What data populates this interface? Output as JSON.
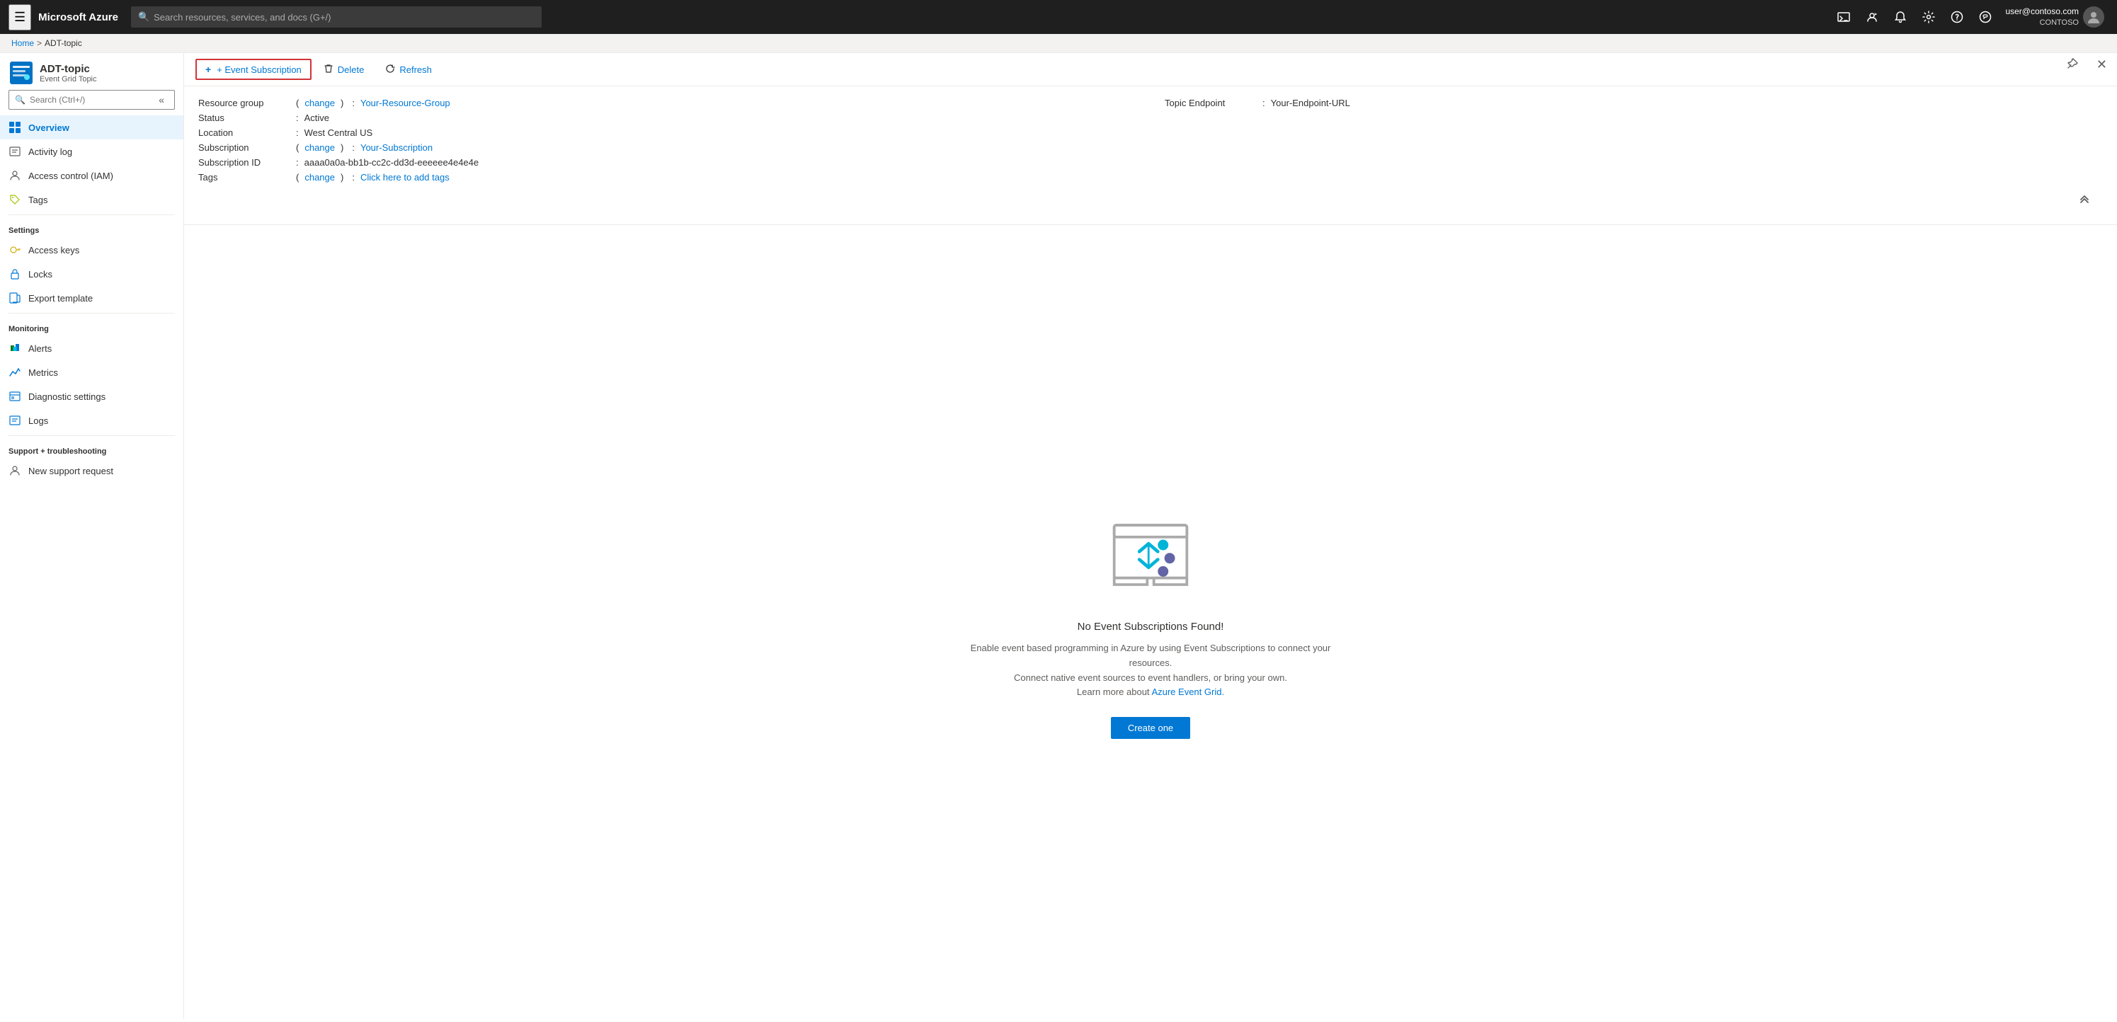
{
  "topnav": {
    "menu_icon": "☰",
    "logo": "Microsoft Azure",
    "search_placeholder": "Search resources, services, and docs (G+/)",
    "cloud_icon": "🖥",
    "feedback_icon": "💬",
    "notification_icon": "🔔",
    "settings_icon": "⚙",
    "help_icon": "?",
    "smiley_icon": "🙂",
    "user_name": "user@contoso.com",
    "user_tenant": "CONTOSO",
    "avatar_initials": "👤"
  },
  "breadcrumb": {
    "home": "Home",
    "separator": ">",
    "current": "ADT-topic"
  },
  "sidebar": {
    "resource_icon": "⊞",
    "title": "ADT-topic",
    "subtitle": "Event Grid Topic",
    "search_placeholder": "Search (Ctrl+/)",
    "collapse_icon": "«",
    "items": [
      {
        "id": "overview",
        "label": "Overview",
        "icon": "⬜",
        "active": true
      },
      {
        "id": "activity-log",
        "label": "Activity log",
        "icon": "📋"
      },
      {
        "id": "access-control",
        "label": "Access control (IAM)",
        "icon": "👤"
      },
      {
        "id": "tags",
        "label": "Tags",
        "icon": "🏷"
      }
    ],
    "sections": [
      {
        "label": "Settings",
        "items": [
          {
            "id": "access-keys",
            "label": "Access keys",
            "icon": "🔑"
          },
          {
            "id": "locks",
            "label": "Locks",
            "icon": "🔒"
          },
          {
            "id": "export-template",
            "label": "Export template",
            "icon": "📄"
          }
        ]
      },
      {
        "label": "Monitoring",
        "items": [
          {
            "id": "alerts",
            "label": "Alerts",
            "icon": "⚡"
          },
          {
            "id": "metrics",
            "label": "Metrics",
            "icon": "📊"
          },
          {
            "id": "diagnostic-settings",
            "label": "Diagnostic settings",
            "icon": "📑"
          },
          {
            "id": "logs",
            "label": "Logs",
            "icon": "📝"
          }
        ]
      },
      {
        "label": "Support + troubleshooting",
        "items": [
          {
            "id": "new-support-request",
            "label": "New support request",
            "icon": "👤"
          }
        ]
      }
    ]
  },
  "toolbar": {
    "event_subscription_label": "+ Event Subscription",
    "delete_label": "Delete",
    "refresh_label": "Refresh",
    "delete_icon": "🗑",
    "refresh_icon": "↺"
  },
  "info_panel": {
    "resource_group_label": "Resource group",
    "resource_group_change": "(change)",
    "resource_group_value": "Your-Resource-Group",
    "topic_endpoint_label": "Topic Endpoint",
    "topic_endpoint_value": "Your-Endpoint-URL",
    "status_label": "Status",
    "status_value": "Active",
    "location_label": "Location",
    "location_value": "West Central US",
    "subscription_label": "Subscription",
    "subscription_change": "(change)",
    "subscription_value": "Your-Subscription",
    "subscription_id_label": "Subscription ID",
    "subscription_id_value": "aaaa0a0a-bb1b-cc2c-dd3d-eeeeee4e4e4e",
    "tags_label": "Tags",
    "tags_change": "(change)",
    "tags_value": "Click here to add tags",
    "collapse_icon": "⌃⌃"
  },
  "empty_state": {
    "title": "No Event Subscriptions Found!",
    "description_line1": "Enable event based programming in Azure by using Event Subscriptions to connect your resources.",
    "description_line2": "Connect native event sources to event handlers, or bring your own.",
    "description_line3_prefix": "Learn more about ",
    "description_link": "Azure Event Grid.",
    "create_btn_label": "Create one"
  },
  "window": {
    "pin_icon": "📌",
    "close_icon": "✕"
  }
}
